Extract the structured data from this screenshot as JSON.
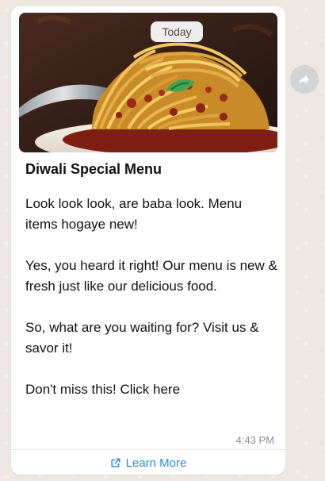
{
  "message": {
    "date_chip": "Today",
    "title": "Diwali Special Menu",
    "paragraphs": [
      "Look look look, are baba look. Menu items hogaye new!",
      "Yes, you heard it right! Our menu is new & fresh just like our delicious food.",
      "So, what are you waiting for? Visit us & savor it!",
      "Don't miss this! Click here"
    ],
    "time": "4:43 PM",
    "cta_label": "Learn More",
    "cta_icon": "external-link-icon"
  },
  "forward_icon": "forward-icon"
}
